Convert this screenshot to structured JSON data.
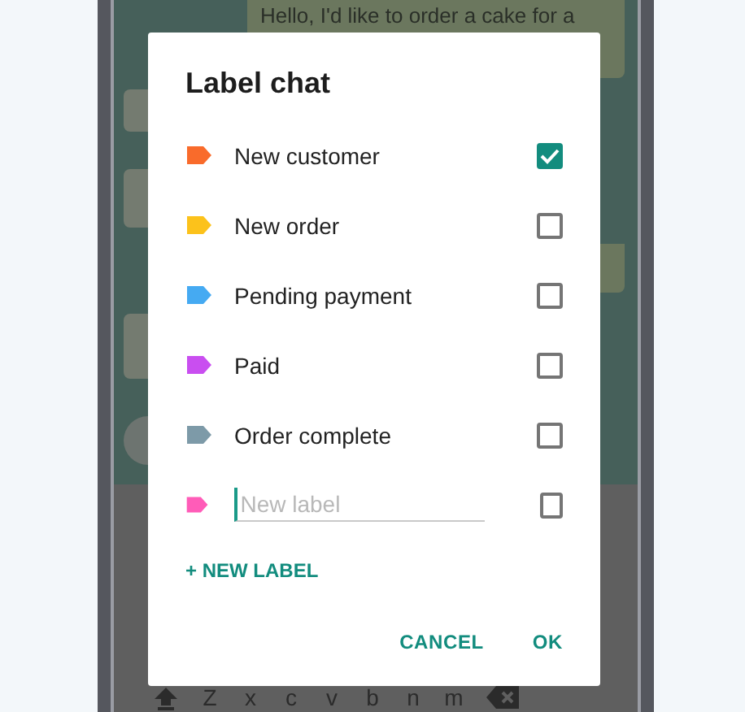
{
  "chat": {
    "messages": [
      {
        "kind": "outgoing",
        "text": "Hello, I'd like to order a cake for a"
      },
      {
        "kind": "incoming"
      },
      {
        "kind": "incoming"
      },
      {
        "kind": "outgoing"
      },
      {
        "kind": "incoming"
      }
    ]
  },
  "keyboard": {
    "keys": [
      "Z",
      "x",
      "c",
      "v",
      "b",
      "n",
      "m"
    ]
  },
  "dialog": {
    "title": "Label chat",
    "labels": [
      {
        "name": "New customer",
        "color": "#f96b2b",
        "checked": true
      },
      {
        "name": "New order",
        "color": "#fcc21b",
        "checked": false
      },
      {
        "name": "Pending payment",
        "color": "#45aaf2",
        "checked": false
      },
      {
        "name": "Paid",
        "color": "#c94ef0",
        "checked": false
      },
      {
        "name": "Order complete",
        "color": "#7d9aa8",
        "checked": false
      }
    ],
    "new_label": {
      "placeholder": "New label",
      "color": "#ff5cb8",
      "checked": false
    },
    "add_button": "+ NEW LABEL",
    "buttons": [
      "CANCEL",
      "OK"
    ]
  }
}
